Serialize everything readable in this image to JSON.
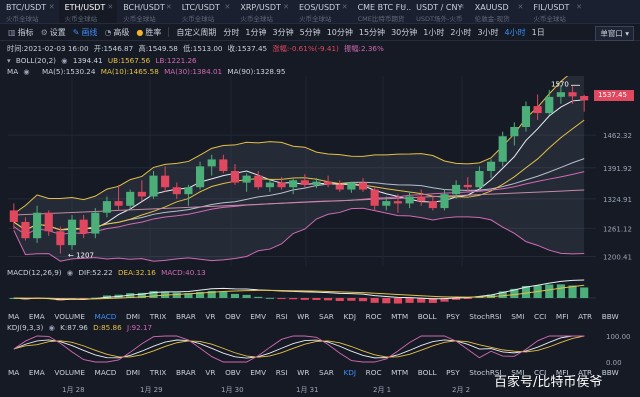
{
  "tabs": [
    {
      "symbol": "BTC/USDT",
      "sub": "火币全球站",
      "active": false
    },
    {
      "symbol": "ETH/USDT",
      "sub": "火币全球站",
      "active": true
    },
    {
      "symbol": "BCH/USDT",
      "sub": "火币全球站",
      "active": false
    },
    {
      "symbol": "LTC/USDT",
      "sub": "火币全球站",
      "active": false
    },
    {
      "symbol": "XRP/USDT",
      "sub": "火币全球站",
      "active": false
    },
    {
      "symbol": "EOS/USDT",
      "sub": "火币全球站",
      "active": false
    },
    {
      "symbol": "CME BTC FU..",
      "sub": "CME比特币期货",
      "active": false
    },
    {
      "symbol": "USDT / CNY",
      "sub": "USDT场外-火币",
      "active": false
    },
    {
      "symbol": "XAUUSD",
      "sub": "伦敦金-现货",
      "active": false
    },
    {
      "symbol": "FIL/USDT",
      "sub": "火币全球站",
      "active": false
    }
  ],
  "toolbar": {
    "indicator": "指标",
    "settings": "设置",
    "draw": "画线",
    "alert": "高级",
    "win_rate": "胜率",
    "custom_period": "自定义周期",
    "timeframes": [
      "分时",
      "1分钟",
      "3分钟",
      "5分钟",
      "10分钟",
      "15分钟",
      "30分钟",
      "1小时",
      "2小时",
      "3小时",
      "4小时",
      "1日"
    ],
    "active_timeframe": "4小时",
    "layout": "单窗口"
  },
  "ohlc": {
    "time": "时间:2021-02-03 16:00",
    "open": "开:1546.87",
    "high": "高:1549.58",
    "low": "低:1513.00",
    "close": "收:1537.45",
    "change": "涨幅:-0.61%(-9.41)",
    "amplitude": "振幅:2.36%"
  },
  "boll": {
    "name": "BOLL(20,2)",
    "mid": "1394.41",
    "ub": "UB:1567.56",
    "lb": "LB:1221.26"
  },
  "ma": {
    "name": "MA",
    "ma5": "MA(5):1530.24",
    "ma10": "MA(10):1465.58",
    "ma30": "MA(30):1384.01",
    "ma90": "MA(90):1328.95"
  },
  "price_axis": [
    "1462.32",
    "1391.92",
    "1324.91",
    "1261.12",
    "1200.41"
  ],
  "current_price": "1537.45",
  "annotations": {
    "high_label": "1570",
    "low_label": "1207"
  },
  "macd": {
    "name": "MACD(12,26,9)",
    "dif": "DIF:52.22",
    "dea": "DEA:32.16",
    "macd": "MACD:40.13"
  },
  "kdj": {
    "name": "KDJ(9,3,3)",
    "k": "K:87.96",
    "d": "D:85.86",
    "j": "J:92.17"
  },
  "kdj_axis": [
    "100.00",
    "0.00"
  ],
  "indicators": [
    "MA",
    "EMA",
    "VOLUME",
    "MACD",
    "DMI",
    "TRIX",
    "BRAR",
    "VR",
    "OBV",
    "EMV",
    "RSI",
    "WR",
    "SAR",
    "KDJ",
    "ROC",
    "MTM",
    "BOLL",
    "PSY",
    "StochRSI",
    "SMI",
    "CCI",
    "MFI",
    "ATR",
    "BBW"
  ],
  "indicators_row1_active": "MACD",
  "indicators_row2_active": "KDJ",
  "dates": [
    "1月 28",
    "1月 29",
    "1月 30",
    "1月 31",
    "2月 1",
    "2月 2"
  ],
  "watermark": "百家号/比特币侯爷",
  "colors": {
    "up": "#4caf7a",
    "down": "#e0485f",
    "accent": "#3d8ef7",
    "background": "#161a25"
  },
  "chart_data": {
    "type": "candlestick",
    "y_range": [
      1180,
      1590
    ],
    "candles": [
      {
        "o": 1300,
        "h": 1315,
        "l": 1260,
        "c": 1275
      },
      {
        "o": 1275,
        "h": 1285,
        "l": 1235,
        "c": 1240
      },
      {
        "o": 1240,
        "h": 1310,
        "l": 1230,
        "c": 1295
      },
      {
        "o": 1295,
        "h": 1300,
        "l": 1245,
        "c": 1255
      },
      {
        "o": 1255,
        "h": 1265,
        "l": 1207,
        "c": 1225
      },
      {
        "o": 1225,
        "h": 1290,
        "l": 1215,
        "c": 1280
      },
      {
        "o": 1280,
        "h": 1290,
        "l": 1240,
        "c": 1250
      },
      {
        "o": 1250,
        "h": 1305,
        "l": 1240,
        "c": 1295
      },
      {
        "o": 1295,
        "h": 1330,
        "l": 1285,
        "c": 1320
      },
      {
        "o": 1320,
        "h": 1355,
        "l": 1300,
        "c": 1310
      },
      {
        "o": 1310,
        "h": 1345,
        "l": 1300,
        "c": 1340
      },
      {
        "o": 1340,
        "h": 1365,
        "l": 1320,
        "c": 1330
      },
      {
        "o": 1330,
        "h": 1385,
        "l": 1325,
        "c": 1375
      },
      {
        "o": 1375,
        "h": 1395,
        "l": 1340,
        "c": 1350
      },
      {
        "o": 1350,
        "h": 1360,
        "l": 1325,
        "c": 1335
      },
      {
        "o": 1335,
        "h": 1355,
        "l": 1310,
        "c": 1350
      },
      {
        "o": 1350,
        "h": 1405,
        "l": 1345,
        "c": 1395
      },
      {
        "o": 1395,
        "h": 1420,
        "l": 1375,
        "c": 1410
      },
      {
        "o": 1410,
        "h": 1420,
        "l": 1380,
        "c": 1385
      },
      {
        "o": 1385,
        "h": 1400,
        "l": 1355,
        "c": 1360
      },
      {
        "o": 1360,
        "h": 1380,
        "l": 1340,
        "c": 1375
      },
      {
        "o": 1375,
        "h": 1385,
        "l": 1345,
        "c": 1350
      },
      {
        "o": 1350,
        "h": 1365,
        "l": 1340,
        "c": 1360
      },
      {
        "o": 1360,
        "h": 1372,
        "l": 1345,
        "c": 1350
      },
      {
        "o": 1350,
        "h": 1368,
        "l": 1335,
        "c": 1365
      },
      {
        "o": 1365,
        "h": 1378,
        "l": 1350,
        "c": 1355
      },
      {
        "o": 1355,
        "h": 1370,
        "l": 1348,
        "c": 1362
      },
      {
        "o": 1362,
        "h": 1375,
        "l": 1350,
        "c": 1356
      },
      {
        "o": 1356,
        "h": 1365,
        "l": 1340,
        "c": 1345
      },
      {
        "o": 1345,
        "h": 1362,
        "l": 1338,
        "c": 1360
      },
      {
        "o": 1360,
        "h": 1370,
        "l": 1340,
        "c": 1345
      },
      {
        "o": 1345,
        "h": 1350,
        "l": 1300,
        "c": 1310
      },
      {
        "o": 1310,
        "h": 1330,
        "l": 1300,
        "c": 1320
      },
      {
        "o": 1320,
        "h": 1335,
        "l": 1295,
        "c": 1315
      },
      {
        "o": 1315,
        "h": 1340,
        "l": 1305,
        "c": 1330
      },
      {
        "o": 1330,
        "h": 1345,
        "l": 1310,
        "c": 1320
      },
      {
        "o": 1320,
        "h": 1330,
        "l": 1300,
        "c": 1305
      },
      {
        "o": 1305,
        "h": 1345,
        "l": 1300,
        "c": 1335
      },
      {
        "o": 1335,
        "h": 1365,
        "l": 1325,
        "c": 1355
      },
      {
        "o": 1355,
        "h": 1372,
        "l": 1340,
        "c": 1350
      },
      {
        "o": 1350,
        "h": 1395,
        "l": 1345,
        "c": 1385
      },
      {
        "o": 1385,
        "h": 1410,
        "l": 1370,
        "c": 1405
      },
      {
        "o": 1405,
        "h": 1470,
        "l": 1395,
        "c": 1460
      },
      {
        "o": 1460,
        "h": 1490,
        "l": 1440,
        "c": 1480
      },
      {
        "o": 1480,
        "h": 1535,
        "l": 1470,
        "c": 1525
      },
      {
        "o": 1525,
        "h": 1550,
        "l": 1495,
        "c": 1510
      },
      {
        "o": 1510,
        "h": 1560,
        "l": 1505,
        "c": 1545
      },
      {
        "o": 1545,
        "h": 1570,
        "l": 1530,
        "c": 1555
      },
      {
        "o": 1555,
        "h": 1568,
        "l": 1530,
        "c": 1546
      },
      {
        "o": 1546.87,
        "h": 1549.58,
        "l": 1513,
        "c": 1537.45
      }
    ]
  }
}
